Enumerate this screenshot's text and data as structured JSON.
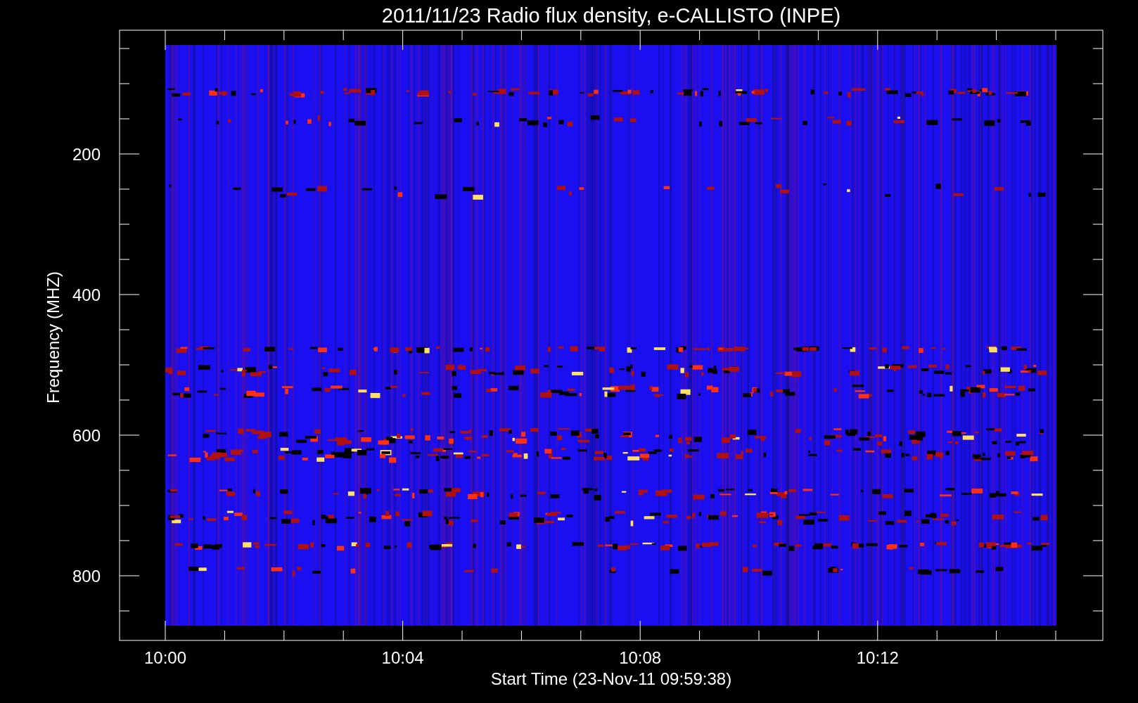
{
  "title": "2011/11/23  Radio flux density, e-CALLISTO (INPE)",
  "y_axis": {
    "label": "Frequency (MHZ)",
    "ticks": [
      "200",
      "400",
      "600",
      "800"
    ]
  },
  "x_axis": {
    "label": "Start Time (23-Nov-11 09:59:38)",
    "ticks": [
      "10:00",
      "10:04",
      "10:08",
      "10:12"
    ]
  }
}
